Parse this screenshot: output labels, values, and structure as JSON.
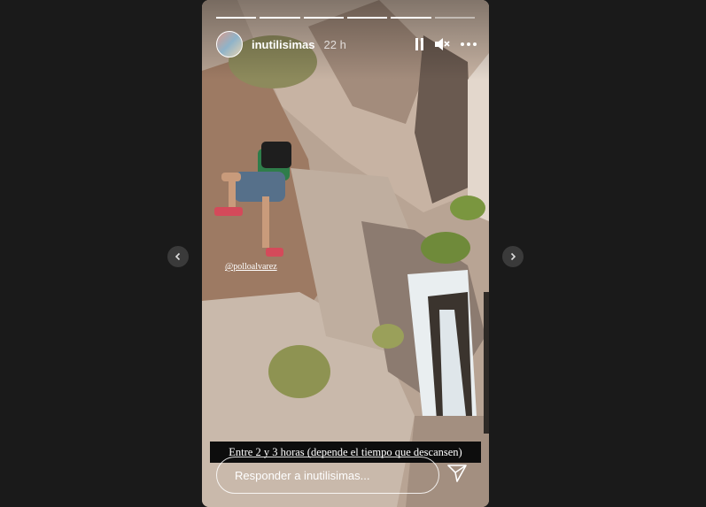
{
  "story": {
    "progress": {
      "total": 6,
      "completed": 5
    },
    "header": {
      "username": "inutilisimas",
      "time_ago": "22 h",
      "icons": [
        "pause-icon",
        "mute-icon",
        "more-icon"
      ]
    },
    "mention": "@polloalvarez",
    "caption": "Entre 2 y 3 horas (depende el tiempo que descansen)",
    "reply": {
      "placeholder": "Responder a inutilisimas..."
    }
  },
  "navigation": {
    "prev_icon": "chevron-left-icon",
    "next_icon": "chevron-right-icon"
  },
  "colors": {
    "background": "#1a1a1a",
    "nav_button": "#3a3a3a",
    "text": "#ffffff"
  }
}
